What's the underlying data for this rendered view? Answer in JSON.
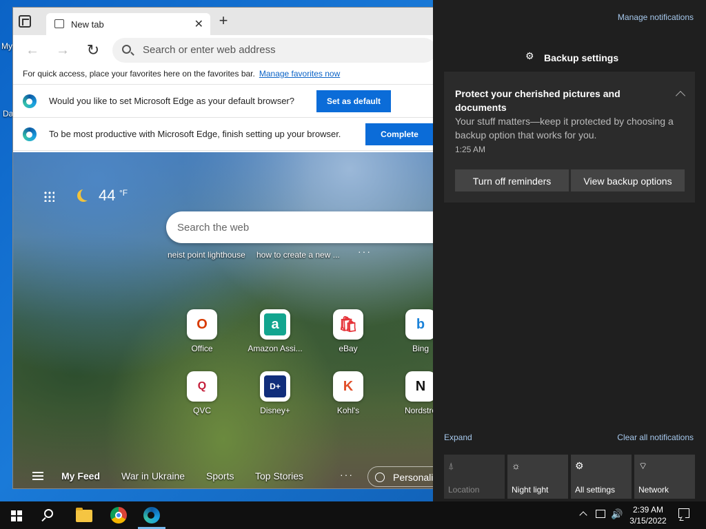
{
  "desktop": {
    "labels": [
      "My",
      "Da"
    ]
  },
  "browser": {
    "tab_title": "New tab",
    "address_placeholder": "Search or enter web address",
    "favbar_text": "For quick access, place your favorites here on the favorites bar.",
    "favbar_link": "Manage favorites now",
    "infobars": [
      {
        "text": "Would you like to set Microsoft Edge as your default browser?",
        "button": "Set as default"
      },
      {
        "text": "To be most productive with Microsoft Edge, finish setting up your browser.",
        "button": "Complete setup"
      }
    ],
    "ntp": {
      "temperature": "44",
      "temp_unit": "°F",
      "search_placeholder": "Search the web",
      "trending": [
        "neist point lighthouse",
        "how to create a new ..."
      ],
      "tiles": [
        {
          "label": "Office",
          "glyph": "O",
          "color": "#d83b01"
        },
        {
          "label": "Amazon Assi...",
          "glyph": "a",
          "color": "#12a58f"
        },
        {
          "label": "eBay",
          "glyph": "🛍",
          "color": "#e53238"
        },
        {
          "label": "Bing",
          "glyph": "b",
          "color": "#1b82d8"
        },
        {
          "label": "QVC",
          "glyph": "Q",
          "color": "#c41e3a"
        },
        {
          "label": "Disney+",
          "glyph": "D+",
          "color": "#112e7b"
        },
        {
          "label": "Kohl's",
          "glyph": "K",
          "color": "#e14f2a"
        },
        {
          "label": "Nordstro",
          "glyph": "N",
          "color": "#111111"
        }
      ],
      "feed": [
        "My Feed",
        "War in Ukraine",
        "Sports",
        "Top Stories"
      ],
      "personalize": "Personaliz"
    }
  },
  "action_center": {
    "manage_notifications": "Manage notifications",
    "app_header": "Backup settings",
    "notification": {
      "title": "Protect your cherished pictures and documents",
      "body": "Your stuff matters—keep it protected by choosing a backup option that works for you.",
      "time": "1:25 AM",
      "buttons": [
        "Turn off reminders",
        "View backup options"
      ]
    },
    "expand": "Expand",
    "clear_all": "Clear all notifications",
    "quick_actions": [
      {
        "label": "Location",
        "icon": "location-icon",
        "glyph": "⍋",
        "disabled": true
      },
      {
        "label": "Night light",
        "icon": "night-light-icon",
        "glyph": "☼",
        "disabled": false
      },
      {
        "label": "All settings",
        "icon": "settings-icon",
        "glyph": "⚙",
        "disabled": false
      },
      {
        "label": "Network",
        "icon": "network-icon",
        "glyph": "⌔",
        "disabled": false
      }
    ]
  },
  "taskbar": {
    "time": "2:39 AM",
    "date": "3/15/2022"
  }
}
